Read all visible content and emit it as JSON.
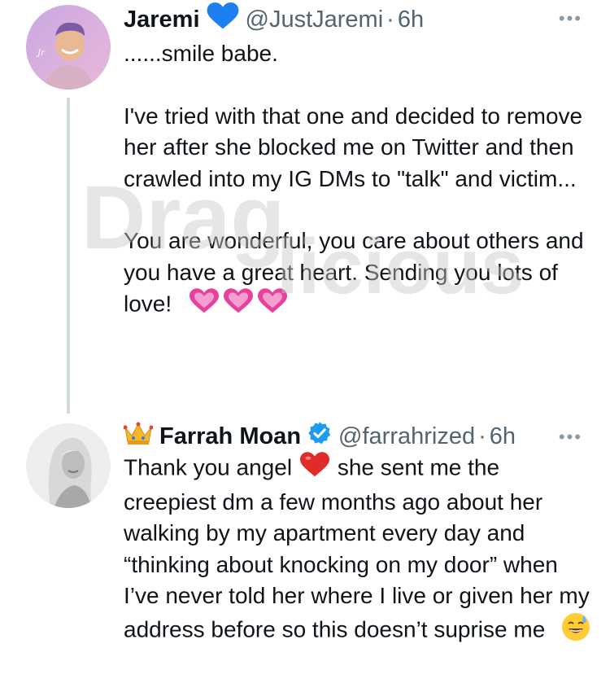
{
  "tweet1": {
    "name": "Jaremi",
    "handle": "@JustJaremi",
    "sep": "·",
    "time": "6h",
    "more": "•••",
    "name_badge_icon": "blue-heart-icon",
    "text_line1": "......smile babe.",
    "text_para2": "I've tried with that one and decided to remove her after she blocked me on Twitter and then crawled into my IG DMs to \"talk\" and victim...",
    "text_para3": "You are wonderful, you care about others and you have a great heart. Sending you lots of love!",
    "trailing_emojis": [
      "pink-heart-icon",
      "pink-heart-icon",
      "pink-heart-icon"
    ]
  },
  "tweet2": {
    "crown_icon": "crown-icon",
    "name": "Farrah Moan",
    "verified_icon": "verified-badge-icon",
    "handle": "@farrahrized",
    "sep": "·",
    "time": "6h",
    "more": "•••",
    "text_part1": "Thank you angel",
    "heart_icon": "red-heart-icon",
    "text_part2": "she sent me the creepiest dm a few months ago about her walking by my apartment every day and “thinking about knocking on my door” when I’ve never told her where I live or given her my address before so this doesn’t suprise me",
    "end_emoji": "sweat-smile-icon"
  },
  "watermark": {
    "text_top": "Drag",
    "text_bottom": "licious"
  },
  "colors": {
    "text": "#0f1419",
    "secondary": "#536471",
    "verified": "#1d9bf0",
    "thread_line": "#cfd9de",
    "blue_heart": "#1d80f0",
    "pink_heart": "#e6419d"
  }
}
